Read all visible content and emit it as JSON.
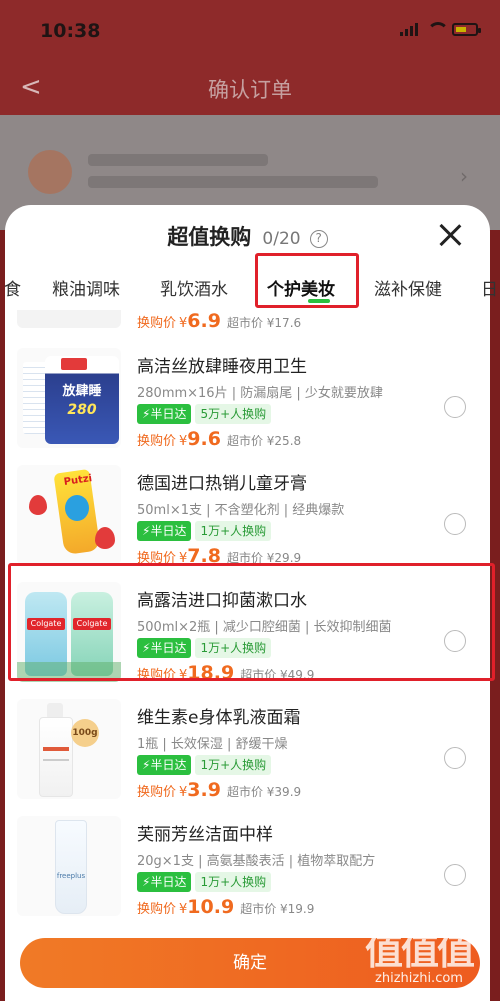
{
  "status_bar": {
    "time": "10:38"
  },
  "nav": {
    "title": "确认订单"
  },
  "sheet": {
    "title": "超值换购",
    "count": "0/20",
    "help": "?"
  },
  "tabs": [
    {
      "label": "食"
    },
    {
      "label": "粮油调味"
    },
    {
      "label": "乳饮酒水"
    },
    {
      "label": "个护美妆",
      "active": true
    },
    {
      "label": "滋补保健"
    },
    {
      "label": "日"
    }
  ],
  "partial_row": {
    "price_label": "换购价",
    "currency": "¥",
    "price": "6.9",
    "market": "超市价 ¥17.6"
  },
  "products": [
    {
      "name": "高洁丝放肆睡夜用卫生",
      "spec": "280mm×16片 | 防漏扇尾 | 少女就要放肆",
      "tag1": "半日达",
      "tag2": "5万+人换购",
      "price_label": "换购价",
      "currency": "¥",
      "price": "9.6",
      "market": "超市价 ¥25.8",
      "thumb_text": "放肆睡",
      "thumb_sub": "280"
    },
    {
      "name": "德国进口热销儿童牙膏",
      "spec": "50ml×1支 | 不含塑化剂 | 经典爆款",
      "tag1": "半日达",
      "tag2": "1万+人换购",
      "price_label": "换购价",
      "currency": "¥",
      "price": "7.8",
      "market": "超市价 ¥29.9",
      "thumb_text": "Putzi"
    },
    {
      "name": "高露洁进口抑菌漱口水",
      "spec": "500ml×2瓶 | 减少口腔细菌 | 长效抑制细菌",
      "tag1": "半日达",
      "tag2": "1万+人换购",
      "price_label": "换购价",
      "currency": "¥",
      "price": "18.9",
      "market": "超市价 ¥49.9",
      "thumb_text": "Colgate"
    },
    {
      "name": "维生素e身体乳液面霜",
      "spec": "1瓶 | 长效保湿 | 舒缓干燥",
      "tag1": "半日达",
      "tag2": "1万+人换购",
      "price_label": "换购价",
      "currency": "¥",
      "price": "3.9",
      "market": "超市价 ¥39.9",
      "thumb_text": "100g"
    },
    {
      "name": "芙丽芳丝洁面中样",
      "spec": "20g×1支 | 高氨基酸表活 | 植物萃取配方",
      "tag1": "半日达",
      "tag2": "1万+人换购",
      "price_label": "换购价",
      "currency": "¥",
      "price": "10.9",
      "market": "超市价 ¥19.9",
      "thumb_text": "freeplus"
    }
  ],
  "confirm_label": "确定",
  "watermark": {
    "logo": "值值值",
    "url": "zhizhizhi.com"
  },
  "colors": {
    "accent": "#f06a1f",
    "green": "#2bbf3f",
    "highlight": "#e0202a"
  }
}
